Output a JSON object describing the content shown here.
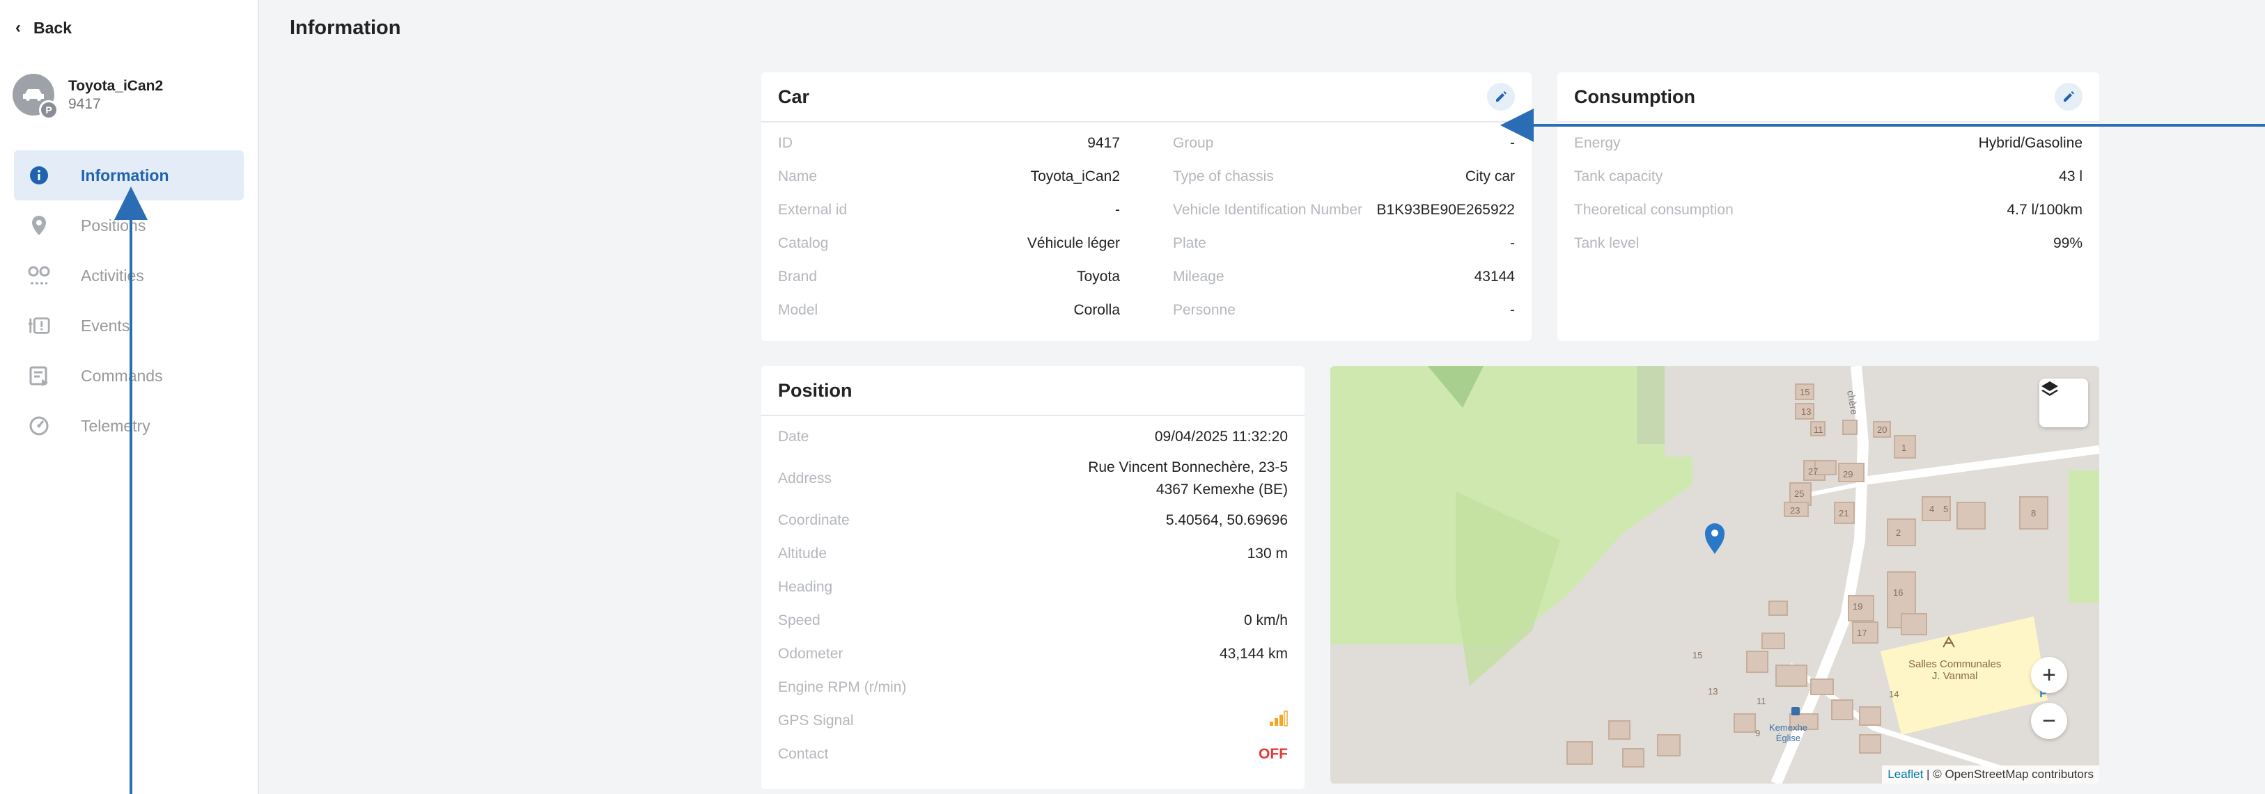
{
  "sidebar": {
    "back_label": "Back",
    "vehicle_name": "Toyota_iCan2",
    "vehicle_id": "9417",
    "avatar_badge": "P",
    "items": [
      {
        "label": "Information",
        "icon": "info-icon",
        "active": true
      },
      {
        "label": "Positions",
        "icon": "location-pin-icon",
        "active": false
      },
      {
        "label": "Activities",
        "icon": "activities-icon",
        "active": false
      },
      {
        "label": "Events",
        "icon": "events-icon",
        "active": false
      },
      {
        "label": "Commands",
        "icon": "commands-icon",
        "active": false
      },
      {
        "label": "Telemetry",
        "icon": "gauge-icon",
        "active": false
      }
    ]
  },
  "page": {
    "title": "Information"
  },
  "car": {
    "title": "Car",
    "left": [
      {
        "label": "ID",
        "value": "9417"
      },
      {
        "label": "Name",
        "value": "Toyota_iCan2"
      },
      {
        "label": "External id",
        "value": "-"
      },
      {
        "label": "Catalog",
        "value": "Véhicule léger"
      },
      {
        "label": "Brand",
        "value": "Toyota"
      },
      {
        "label": "Model",
        "value": "Corolla"
      }
    ],
    "right": [
      {
        "label": "Group",
        "value": "-"
      },
      {
        "label": "Type of chassis",
        "value": "City car"
      },
      {
        "label": "Vehicle Identification Number",
        "value": "B1K93BE90E265922"
      },
      {
        "label": "Plate",
        "value": "-"
      },
      {
        "label": "Mileage",
        "value": "43144"
      },
      {
        "label": "Personne",
        "value": "-"
      }
    ]
  },
  "consumption": {
    "title": "Consumption",
    "rows": [
      {
        "label": "Energy",
        "value": "Hybrid/Gasoline"
      },
      {
        "label": "Tank capacity",
        "value": "43 l"
      },
      {
        "label": "Theoretical consumption",
        "value": "4.7 l/100km"
      },
      {
        "label": "Tank level",
        "value": "99%"
      }
    ]
  },
  "position": {
    "title": "Position",
    "date_label": "Date",
    "date_value": "09/04/2025 11:32:20",
    "address_label": "Address",
    "address_line1": "Rue Vincent Bonnechère, 23-5",
    "address_line2": "4367 Kemexhe (BE)",
    "coordinate_label": "Coordinate",
    "coordinate_value": "5.40564, 50.69696",
    "altitude_label": "Altitude",
    "altitude_value": "130 m",
    "heading_label": "Heading",
    "heading_value": "",
    "speed_label": "Speed",
    "speed_value": "0 km/h",
    "odometer_label": "Odometer",
    "odometer_value": "43,144 km",
    "rpm_label": "Engine RPM (r/min)",
    "rpm_value": "",
    "gps_label": "GPS Signal",
    "contact_label": "Contact",
    "contact_value": "OFF"
  },
  "map": {
    "zoom_in": "+",
    "zoom_out": "−",
    "attribution_leaflet": "Leaflet",
    "attribution_rest": " | © OpenStreetMap contributors",
    "poi_salles_line1": "Salles Communales",
    "poi_salles_line2": "J. Vanmal",
    "poi_bus_line1": "Kemexhe",
    "poi_bus_line2": "Église",
    "street_label": "chère",
    "house_numbers": [
      "15",
      "13",
      "11",
      "20",
      "1",
      "27",
      "25",
      "23",
      "29",
      "21",
      "4",
      "5",
      "8",
      "2",
      "19",
      "17",
      "16",
      "15",
      "13",
      "11",
      "9",
      "14"
    ]
  },
  "colors": {
    "accent": "#1f63b0",
    "active_bg": "#e4edf7",
    "off": "#e53935",
    "gps": "#f5a623",
    "annotation": "#2a6db5"
  }
}
